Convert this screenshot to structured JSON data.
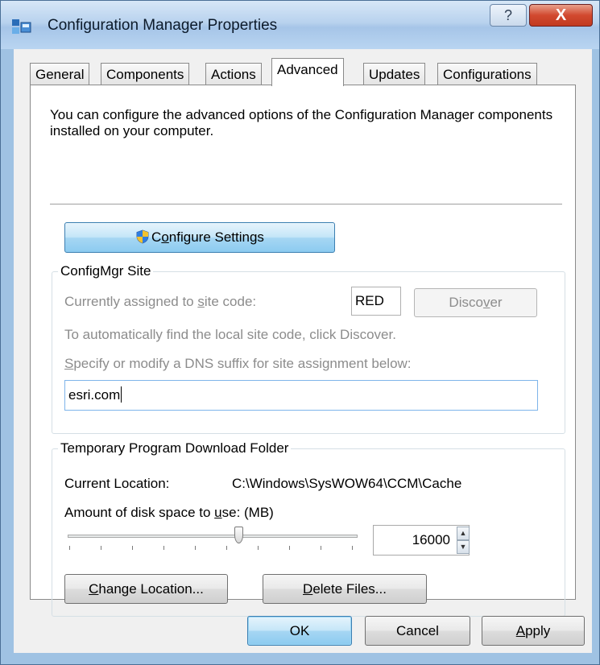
{
  "window": {
    "title": "Configuration Manager Properties",
    "help_label": "?",
    "close_label": "X"
  },
  "tabs": [
    {
      "label": "General"
    },
    {
      "label": "Components"
    },
    {
      "label": "Actions"
    },
    {
      "label": "Advanced",
      "active": true
    },
    {
      "label": "Updates"
    },
    {
      "label": "Configurations"
    }
  ],
  "advanced": {
    "intro": "You can configure the advanced options of the Configuration Manager components installed on your computer.",
    "configure_button": {
      "pre": "C",
      "underlined": "o",
      "post": "nfigure Settings"
    },
    "site_group": {
      "legend": "ConfigMgr Site",
      "assigned_label": {
        "pre": "Currently assigned to ",
        "underlined": "s",
        "post": "ite code:"
      },
      "site_code": "RED",
      "discover_button": {
        "pre": "Disco",
        "underlined": "v",
        "post": "er"
      },
      "auto_find_text": "To automatically find the local site code, click Discover.",
      "dns_label": {
        "pre": "",
        "underlined": "S",
        "post": "pecify or modify a DNS suffix for site assignment below:"
      },
      "dns_value": "esri.com"
    },
    "temp_group": {
      "legend": "Temporary Program Download Folder",
      "current_location_label": "Current Location:",
      "current_location_value": "C:\\Windows\\SysWOW64\\CCM\\Cache",
      "disk_space_label": {
        "pre": "Amount of disk space to ",
        "underlined": "u",
        "post": "se: (MB)"
      },
      "disk_space_value": "16000",
      "slider_fraction": 0.59,
      "change_location_button": {
        "pre": "",
        "underlined": "C",
        "post": "hange Location..."
      },
      "delete_files_button": {
        "pre": "",
        "underlined": "D",
        "post": "elete Files..."
      }
    }
  },
  "footer": {
    "ok": "OK",
    "cancel": "Cancel",
    "apply": {
      "pre": "",
      "underlined": "A",
      "post": "pply"
    }
  }
}
